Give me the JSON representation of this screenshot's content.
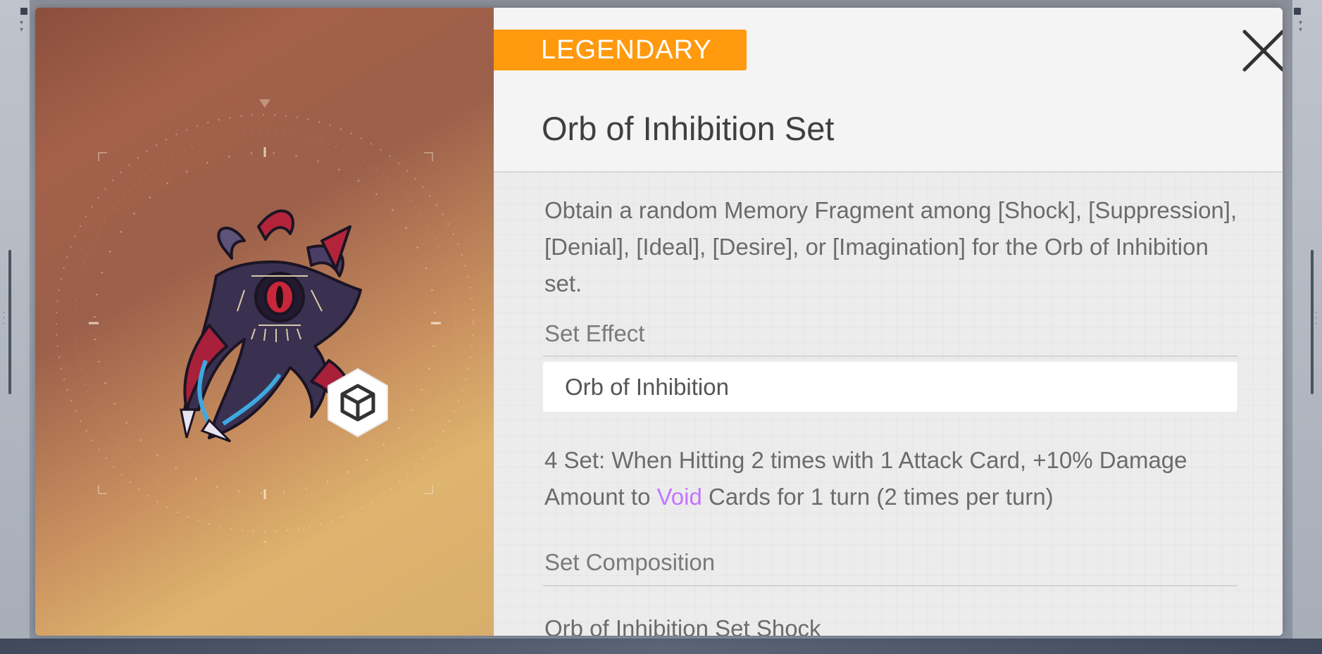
{
  "window": {
    "left_handles": [
      "drag-handle",
      "scroll-handle"
    ],
    "right_handles": [
      "drag-handle",
      "scroll-handle"
    ]
  },
  "item": {
    "rarity": "LEGENDARY",
    "title": "Orb of Inhibition Set",
    "description": "Obtain a random Memory Fragment among [Shock], [Suppression], [Denial], [Ideal], [Desire], or [Imagination] for the Orb of Inhibition set.",
    "type_icon": "cube-icon"
  },
  "set_effect": {
    "label": "Set Effect",
    "set_name": "Orb of Inhibition",
    "effect_prefix": "4 Set: When Hitting 2 times with 1 Attack Card, +10% Damage Amount to ",
    "effect_keyword": "Void",
    "effect_suffix": " Cards for 1 turn (2 times per turn)"
  },
  "set_composition": {
    "label": "Set Composition",
    "items": [
      "Orb of Inhibition Set Shock"
    ]
  },
  "colors": {
    "rarity": "#ff9a0e",
    "void_keyword": "#c474ff",
    "title_text": "#3f3f3f",
    "body_text": "#6b6b6b"
  },
  "icons": {
    "close": "close-icon"
  }
}
